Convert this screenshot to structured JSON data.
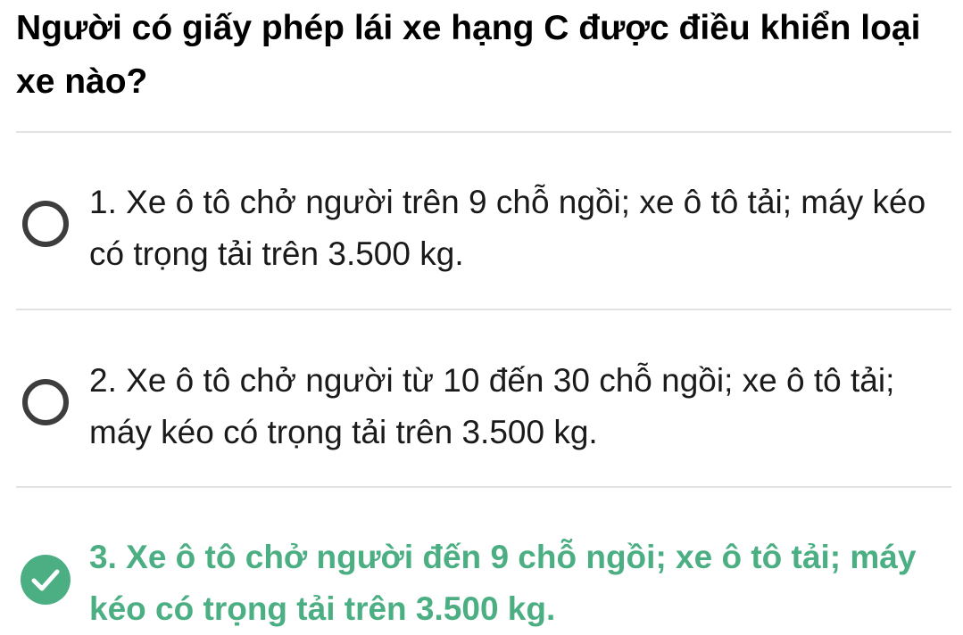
{
  "question": {
    "text": "Người có giấy phép lái xe hạng C được điều khiển loại xe nào?"
  },
  "answers": [
    {
      "text": "1. Xe ô tô chở người trên 9 chỗ ngồi; xe ô tô tải; máy kéo có trọng tải trên 3.500 kg.",
      "selected": false,
      "correct": false
    },
    {
      "text": "2. Xe ô tô chở người từ 10 đến 30 chỗ ngồi; xe ô tô tải; máy kéo có trọng tải trên 3.500 kg.",
      "selected": false,
      "correct": false
    },
    {
      "text": "3. Xe ô tô chở người đến 9 chỗ ngồi; xe ô tô tải; máy kéo có trọng tải trên 3.500 kg.",
      "selected": true,
      "correct": true
    }
  ],
  "colors": {
    "correct": "#4caf83",
    "radio_border": "#3d3d3d",
    "divider": "#e2e2e2"
  },
  "icons": {
    "unchecked": "radio-unchecked-icon",
    "checked": "checkmark-circle-icon"
  }
}
